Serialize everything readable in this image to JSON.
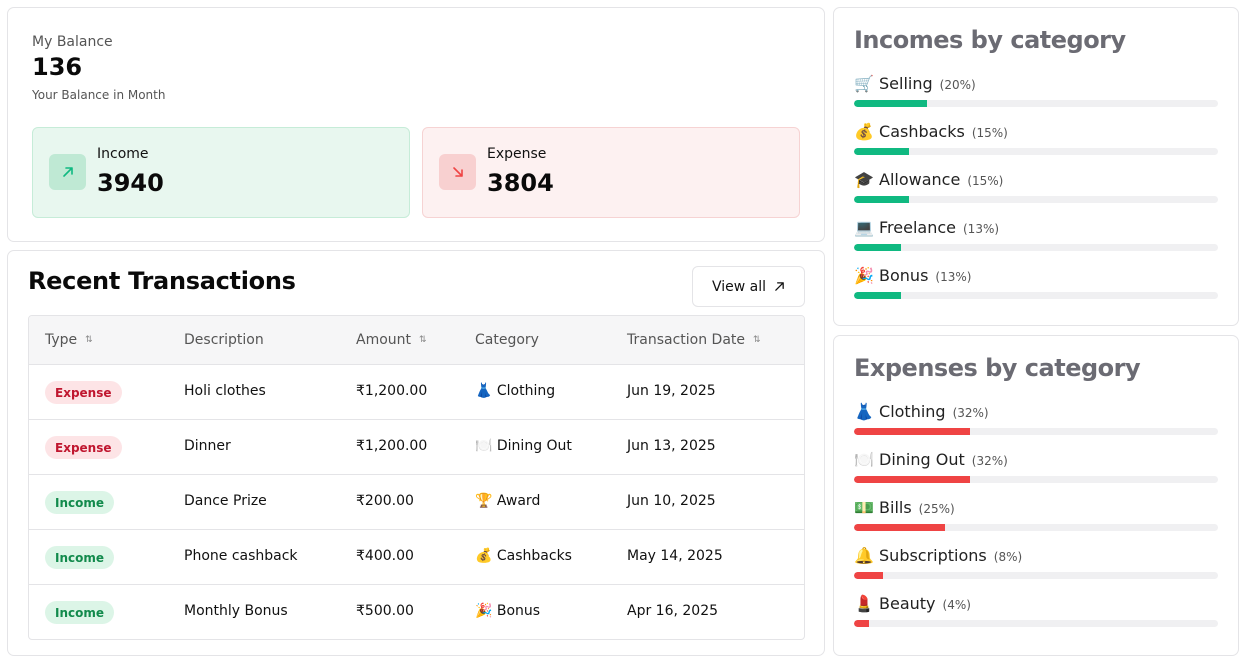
{
  "balance": {
    "label": "My Balance",
    "value": "136",
    "subtitle": "Your Balance in Month",
    "income": {
      "label": "Income",
      "value": "3940",
      "icon": "arrow-up-right-icon",
      "accent": "#10b981"
    },
    "expense": {
      "label": "Expense",
      "value": "3804",
      "icon": "arrow-down-right-icon",
      "accent": "#ef4444"
    }
  },
  "transactions": {
    "title": "Recent Transactions",
    "view_all_label": "View all",
    "columns": [
      "Type",
      "Description",
      "Amount",
      "Category",
      "Transaction Date"
    ],
    "sortable_columns": [
      "Type",
      "Amount",
      "Transaction Date"
    ],
    "rows": [
      {
        "type": "Expense",
        "description": "Holi clothes",
        "amount": "₹1,200.00",
        "category_icon": "👗",
        "category": "Clothing",
        "date": "Jun 19, 2025"
      },
      {
        "type": "Expense",
        "description": "Dinner",
        "amount": "₹1,200.00",
        "category_icon": "🍽️",
        "category": "Dining Out",
        "date": "Jun 13, 2025"
      },
      {
        "type": "Income",
        "description": "Dance Prize",
        "amount": "₹200.00",
        "category_icon": "🏆",
        "category": "Award",
        "date": "Jun 10, 2025"
      },
      {
        "type": "Income",
        "description": "Phone cashback",
        "amount": "₹400.00",
        "category_icon": "💰",
        "category": "Cashbacks",
        "date": "May 14, 2025"
      },
      {
        "type": "Income",
        "description": "Monthly Bonus",
        "amount": "₹500.00",
        "category_icon": "🎉",
        "category": "Bonus",
        "date": "Apr 16, 2025"
      }
    ]
  },
  "incomes_by_category": {
    "title": "Incomes by category",
    "bar_color": "#10b981",
    "items": [
      {
        "icon": "🛒",
        "name": "Selling",
        "pct_label": "(20%)",
        "pct": 20
      },
      {
        "icon": "💰",
        "name": "Cashbacks",
        "pct_label": "(15%)",
        "pct": 15
      },
      {
        "icon": "🎓",
        "name": "Allowance",
        "pct_label": "(15%)",
        "pct": 15
      },
      {
        "icon": "💻",
        "name": "Freelance",
        "pct_label": "(13%)",
        "pct": 13
      },
      {
        "icon": "🎉",
        "name": "Bonus",
        "pct_label": "(13%)",
        "pct": 13
      }
    ]
  },
  "expenses_by_category": {
    "title": "Expenses by category",
    "bar_color": "#ef4444",
    "items": [
      {
        "icon": "👗",
        "name": "Clothing",
        "pct_label": "(32%)",
        "pct": 32
      },
      {
        "icon": "🍽️",
        "name": "Dining Out",
        "pct_label": "(32%)",
        "pct": 32
      },
      {
        "icon": "💵",
        "name": "Bills",
        "pct_label": "(25%)",
        "pct": 25
      },
      {
        "icon": "🔔",
        "name": "Subscriptions",
        "pct_label": "(8%)",
        "pct": 8
      },
      {
        "icon": "💄",
        "name": "Beauty",
        "pct_label": "(4%)",
        "pct": 4
      }
    ]
  }
}
